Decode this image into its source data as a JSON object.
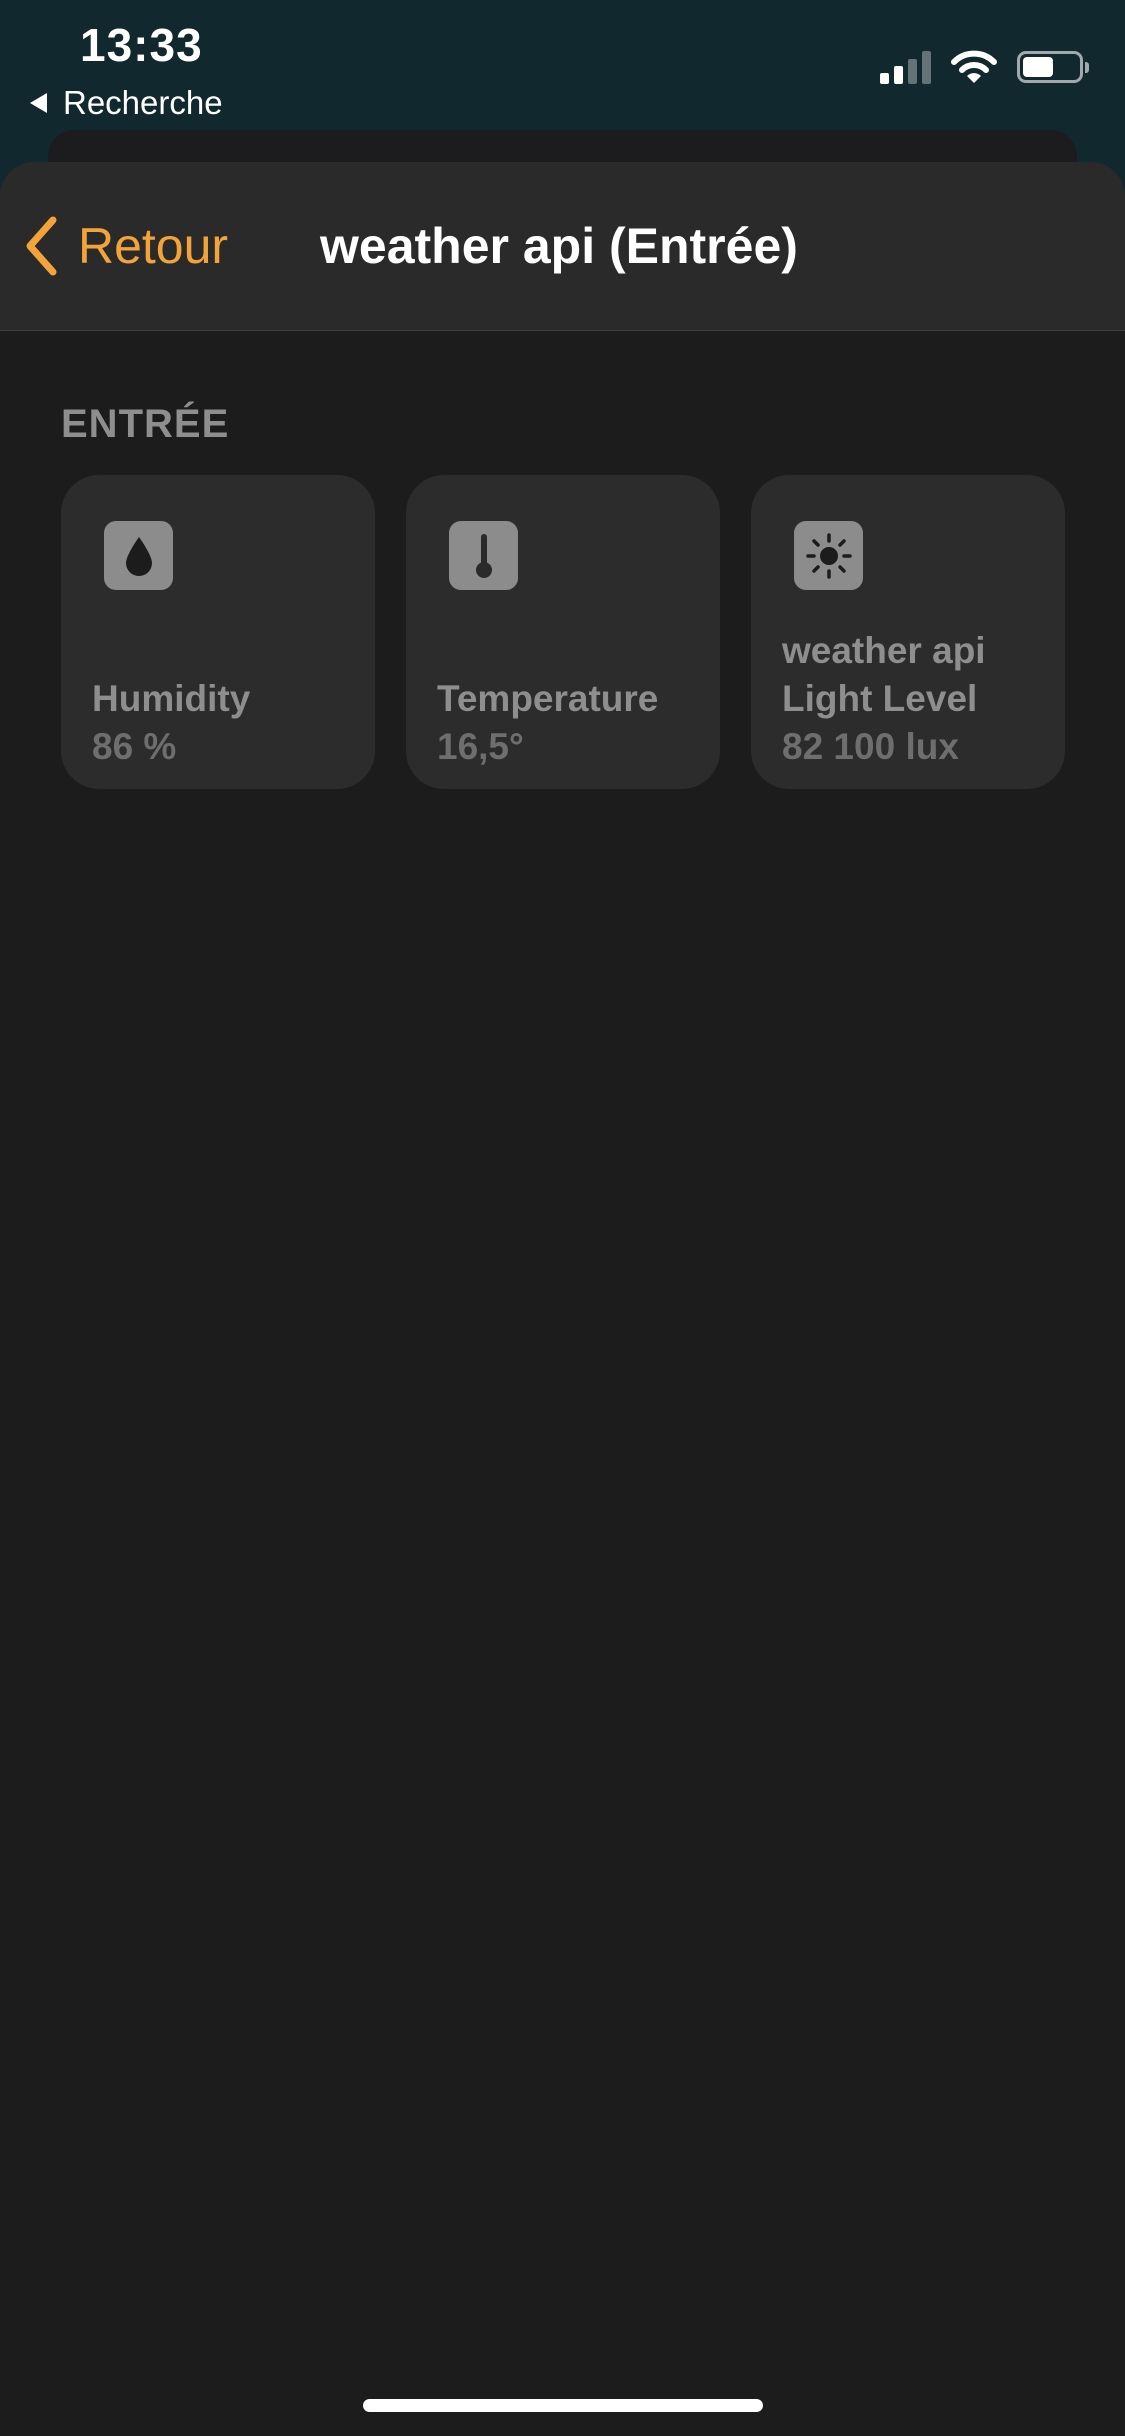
{
  "status_bar": {
    "time": "13:33",
    "back_app_label": "Recherche",
    "signal_icon": "cellular-signal-icon",
    "wifi_icon": "wifi-icon",
    "battery_icon": "battery-icon",
    "battery_level": 0.55
  },
  "nav": {
    "back_label": "Retour",
    "title": "weather api (Entrée)",
    "accent_color": "#f2a43a"
  },
  "section": {
    "header": "ENTRÉE"
  },
  "tiles": [
    {
      "icon": "water-drop-icon",
      "name": "Humidity",
      "value": "86 %"
    },
    {
      "icon": "thermometer-icon",
      "name": "Temperature",
      "value": "16,5°"
    },
    {
      "icon": "sun-icon",
      "name": "weather api Light Level",
      "name_line1": "weather api",
      "name_line2": "Light Level",
      "value": "82 100 lux"
    }
  ],
  "colors": {
    "background": "#1c1c1c",
    "tile": "#2c2c2c",
    "secondary_text": "#8e8e8e"
  }
}
